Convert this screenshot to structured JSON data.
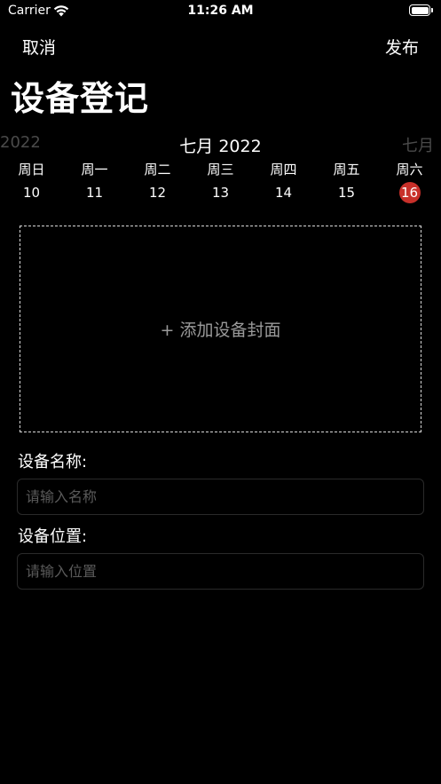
{
  "status_bar": {
    "carrier": "Carrier",
    "time": "11:26 AM"
  },
  "nav": {
    "cancel_label": "取消",
    "publish_label": "发布",
    "title": "设备登记"
  },
  "calendar": {
    "prev_label": "2022",
    "current_label": "七月 2022",
    "next_label": "七月",
    "weekdays": [
      "周日",
      "周一",
      "周二",
      "周三",
      "周四",
      "周五",
      "周六"
    ],
    "days": [
      "10",
      "11",
      "12",
      "13",
      "14",
      "15",
      "16"
    ],
    "selected_day": "16",
    "selected_color": "#c8302a"
  },
  "cover": {
    "label": "+ 添加设备封面"
  },
  "form": {
    "name_label": "设备名称:",
    "name_placeholder": "请输入名称",
    "name_value": "",
    "location_label": "设备位置:",
    "location_placeholder": "请输入位置",
    "location_value": ""
  }
}
